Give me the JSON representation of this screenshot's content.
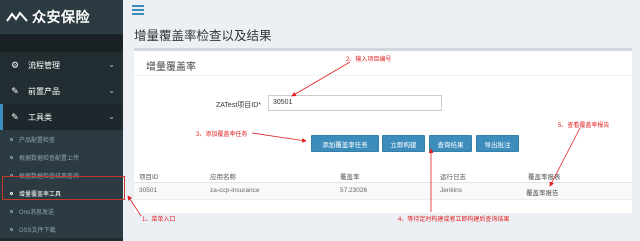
{
  "sidebar": {
    "logo_text": "众安保险",
    "menu": [
      {
        "label": "流程管理"
      },
      {
        "label": "前置产品"
      },
      {
        "label": "工具类"
      }
    ],
    "submenu": [
      {
        "label": "产品配置检查"
      },
      {
        "label": "根据数据检查配置上传"
      },
      {
        "label": "根据数据检查结果查询"
      },
      {
        "label": "增量覆盖率工具"
      },
      {
        "label": "Ons消息发送"
      },
      {
        "label": "OSS文件下载"
      }
    ]
  },
  "page": {
    "title": "增量覆盖率检查以及结果",
    "box_title": "增量覆盖率",
    "form": {
      "label": "ZATest项目ID*",
      "value": "30501"
    },
    "buttons": {
      "add": "添加覆盖率任务",
      "build": "立即构建",
      "query": "查询结果",
      "export": "导出批注"
    },
    "table": {
      "headers": [
        "项目ID",
        "应用名称",
        "覆盖率",
        "运行日志",
        "覆盖率报表"
      ],
      "rows": [
        [
          "30501",
          "za-ccp-insurance",
          "57.23026",
          "Jenkins",
          "覆盖率报告"
        ]
      ]
    }
  },
  "annotations": {
    "a1": "1、菜单入口",
    "a2": "2、输入项目编号",
    "a3": "3、添加覆盖率任务",
    "a4": "4、等待定时构建或者立即构建后查询结果",
    "a5": "5、查看覆盖率报告"
  }
}
